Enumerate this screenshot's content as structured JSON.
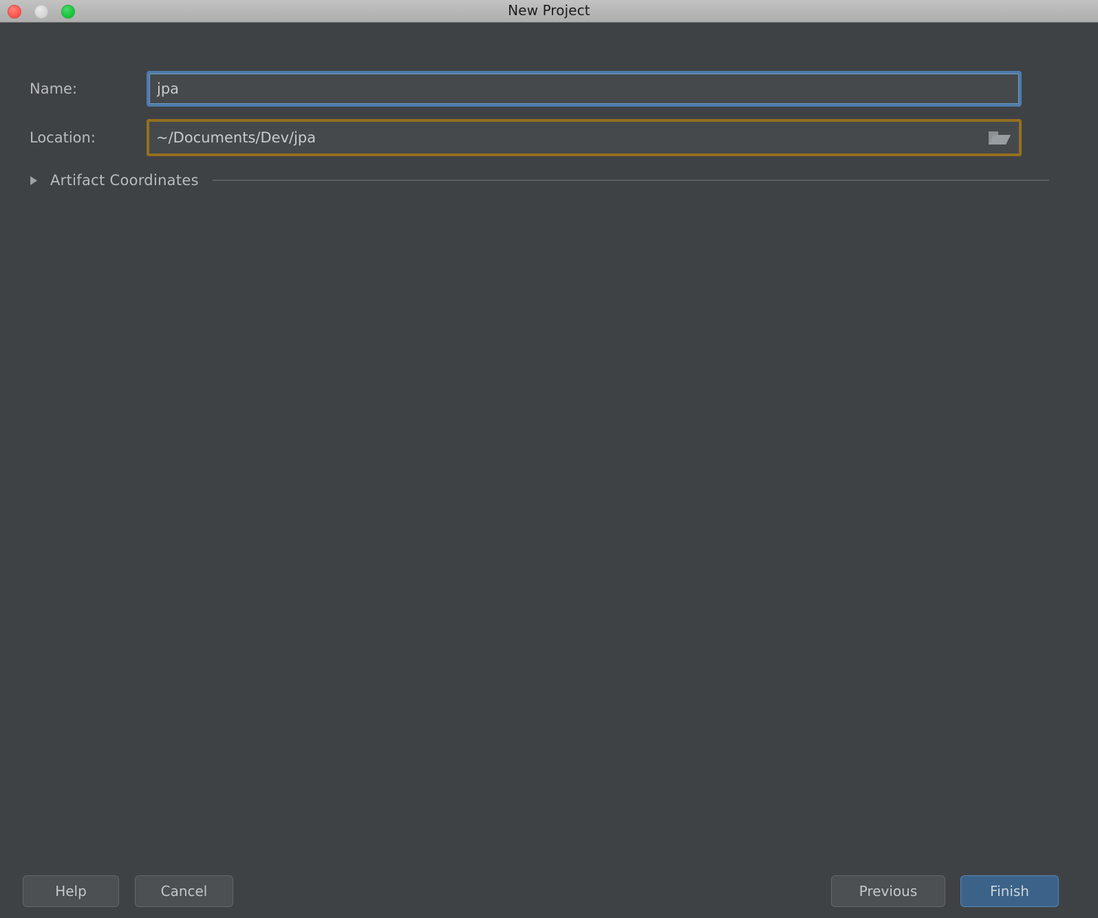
{
  "window": {
    "title": "New Project",
    "traffic_lights": [
      {
        "name": "close",
        "color": "#fb5a52"
      },
      {
        "name": "minimize",
        "color": "#d9d9d9"
      },
      {
        "name": "maximize",
        "color": "#1ec641"
      }
    ]
  },
  "form": {
    "name": {
      "label": "Name:",
      "value": "jpa",
      "placeholder": "",
      "focused": true,
      "focus_ring_color": "#4e7ba8"
    },
    "location": {
      "label": "Location:",
      "value": "~/Documents/Dev/jpa",
      "placeholder": "",
      "border_color": "#94701f",
      "browse_icon": "folder-open-icon"
    }
  },
  "sections": {
    "artifact_coordinates": {
      "title": "Artifact Coordinates",
      "expanded": false,
      "disclosure_icon": "triangle-right-icon"
    }
  },
  "footer": {
    "help_label": "Help",
    "cancel_label": "Cancel",
    "previous_label": "Previous",
    "finish_label": "Finish",
    "finish_accent_color": "#3b638a"
  }
}
